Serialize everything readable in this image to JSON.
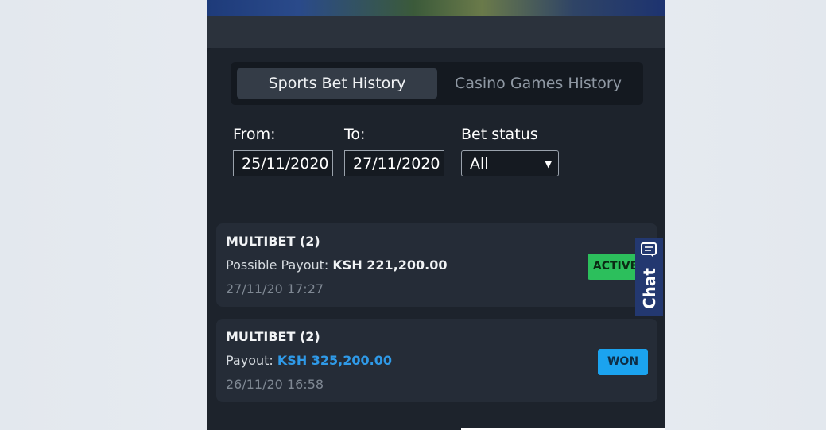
{
  "tabs": [
    {
      "label": "Sports Bet History",
      "active": true
    },
    {
      "label": "Casino Games History",
      "active": false
    }
  ],
  "filters": {
    "from_label": "From:",
    "from_value": "25/11/2020",
    "to_label": "To:",
    "to_value": "27/11/2020",
    "status_label": "Bet status",
    "status_value": "All"
  },
  "bets": [
    {
      "title": "MULTIBET (2)",
      "payout_label": "Possible Payout:",
      "payout_value": "KSH 221,200.00",
      "date": "27/11/20 17:27",
      "status": "ACTIVE"
    },
    {
      "title": "MULTIBET (2)",
      "payout_label": "Payout:",
      "payout_value": "KSH 325,200.00",
      "date": "26/11/20 16:58",
      "status": "WON"
    }
  ],
  "chat": {
    "label": "Chat",
    "icon": "chat-bubble-icon"
  },
  "colors": {
    "background": "#1d232c",
    "active_badge": "#2cbf5c",
    "won_badge": "#1ba3ef",
    "payout_highlight": "#2f9ae8",
    "chat_tab": "#233870"
  }
}
